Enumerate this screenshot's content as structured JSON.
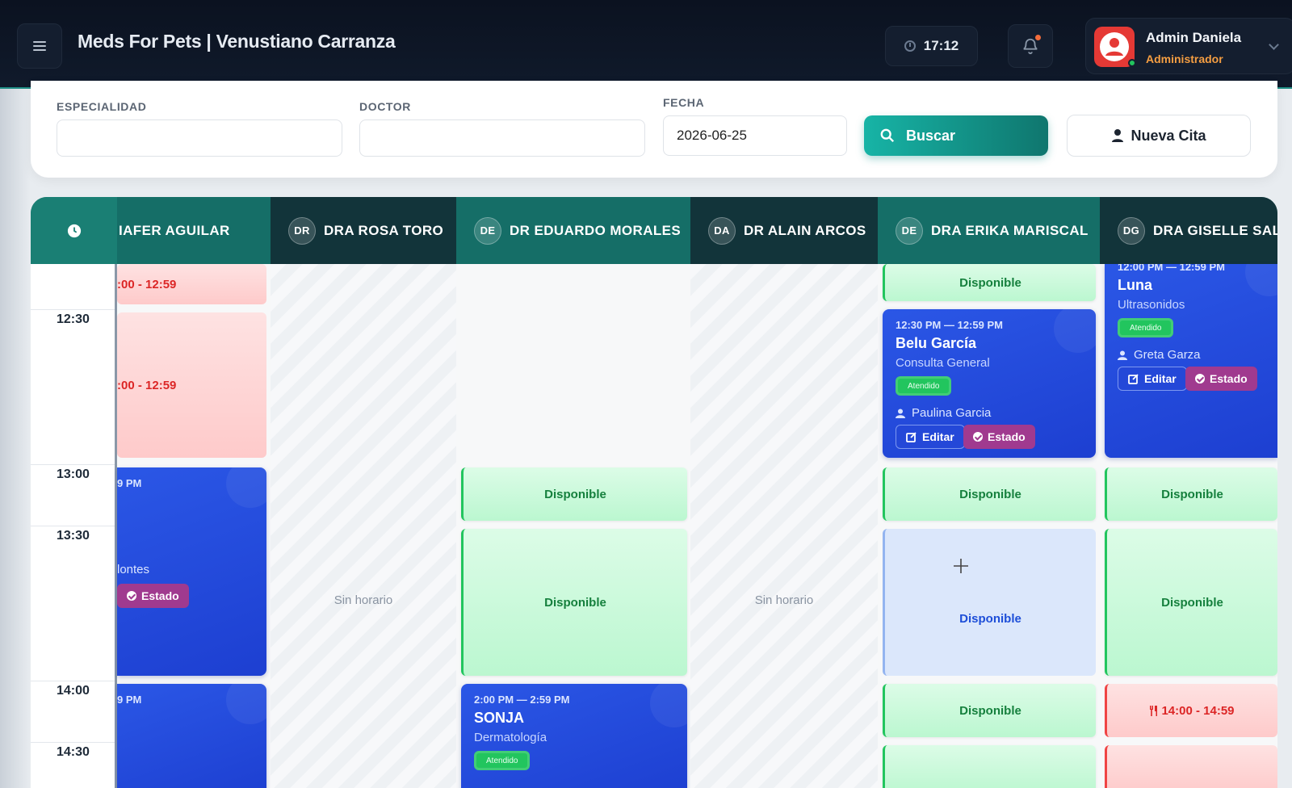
{
  "header": {
    "title": "Meds For Pets | Venustiano Carranza",
    "clock": "17:12",
    "user_name": "Admin Daniela",
    "user_role": "Administrador"
  },
  "filters": {
    "especialidad_label": "ESPECIALIDAD",
    "doctor_label": "DOCTOR",
    "fecha_label": "FECHA",
    "fecha_value": "2026-06-25",
    "buscar_label": "Buscar",
    "nueva_label": "Nueva Cita"
  },
  "columns": [
    {
      "initials": "",
      "name": "IAFER AGUILAR"
    },
    {
      "initials": "DR",
      "name": "DRA ROSA TORO"
    },
    {
      "initials": "DE",
      "name": "DR EDUARDO MORALES"
    },
    {
      "initials": "DA",
      "name": "DR ALAIN ARCOS"
    },
    {
      "initials": "DE",
      "name": "DRA ERIKA MARISCAL"
    },
    {
      "initials": "DG",
      "name": "DRA GISELLE SALINAS"
    }
  ],
  "times": [
    "12:30",
    "13:00",
    "13:30",
    "14:00",
    "14:30"
  ],
  "labels": {
    "disponible": "Disponible",
    "sin_horario": "Sin horario",
    "editar": "Editar",
    "estado": "Estado",
    "atendido": "Atendido"
  },
  "col0": {
    "block1": ":00 - 12:59",
    "block2": ":00 - 12:59",
    "appt1_time": "9 PM",
    "appt1_owner": "lontes",
    "appt2_time": "9 PM"
  },
  "eduardo": {
    "appt_time": "2:00 PM — 2:59 PM",
    "appt_name": "SONJA",
    "appt_service": "Dermatología"
  },
  "erika": {
    "appt_time": "12:30 PM — 12:59 PM",
    "appt_name": "Belu García",
    "appt_service": "Consulta General",
    "appt_owner": "Paulina Garcia"
  },
  "giselle": {
    "appt_time": "12:00 PM — 12:59 PM",
    "appt_name": "Luna",
    "appt_service": "Ultrasonidos",
    "appt_owner": "Greta Garza",
    "blocked": "14:00 - 14:59"
  },
  "colors": {
    "accent": "#0f766e",
    "appointment": "#2b57e6",
    "available": "#22c55e",
    "blocked": "#ef4444",
    "estado": "#a03a8f"
  }
}
